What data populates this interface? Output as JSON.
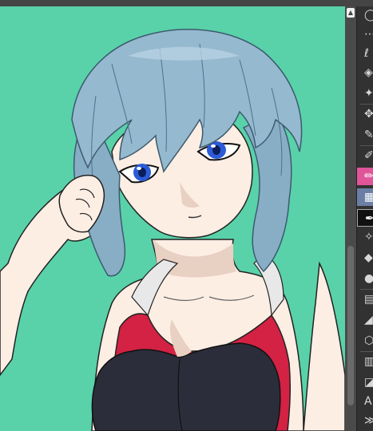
{
  "app": {
    "name": "drawing-app",
    "canvas_background": "#59d2a9"
  },
  "colors": {
    "accent": "#e0559a",
    "selection": "#6b7fa6",
    "toolbar_bg": "#323232"
  },
  "scrollbar": {
    "up_arrow": "▲"
  },
  "toolbar": {
    "tools": [
      {
        "name": "ellipse-select-icon",
        "glyph": "◯"
      },
      {
        "name": "lasso-dotted-icon",
        "glyph": "⋯"
      },
      {
        "name": "lasso-icon",
        "glyph": "ℓ"
      },
      {
        "name": "layers-icon",
        "glyph": "◈"
      },
      {
        "name": "magic-wand-icon",
        "glyph": "✦"
      },
      {
        "name": "move-icon",
        "glyph": "✥"
      },
      {
        "name": "pen-icon",
        "glyph": "✎"
      },
      {
        "name": "pencil-icon",
        "glyph": "✐"
      },
      {
        "name": "marker-icon",
        "glyph": "✏"
      },
      {
        "name": "brush-icon",
        "glyph": "▦"
      },
      {
        "name": "ink-icon",
        "glyph": "✒"
      },
      {
        "name": "sparkle-icon",
        "glyph": "✧"
      },
      {
        "name": "eraser-icon",
        "glyph": "◆"
      },
      {
        "name": "blend-icon",
        "glyph": "●"
      },
      {
        "name": "gradient-icon",
        "glyph": "▤"
      },
      {
        "name": "fill-icon",
        "glyph": "◢"
      },
      {
        "name": "shape-icon",
        "glyph": "⬡"
      },
      {
        "name": "grid-icon",
        "glyph": "▥"
      },
      {
        "name": "frame-icon",
        "glyph": "◪"
      },
      {
        "name": "text-icon",
        "glyph": "A"
      },
      {
        "name": "balloon-icon",
        "glyph": "≫"
      }
    ]
  }
}
